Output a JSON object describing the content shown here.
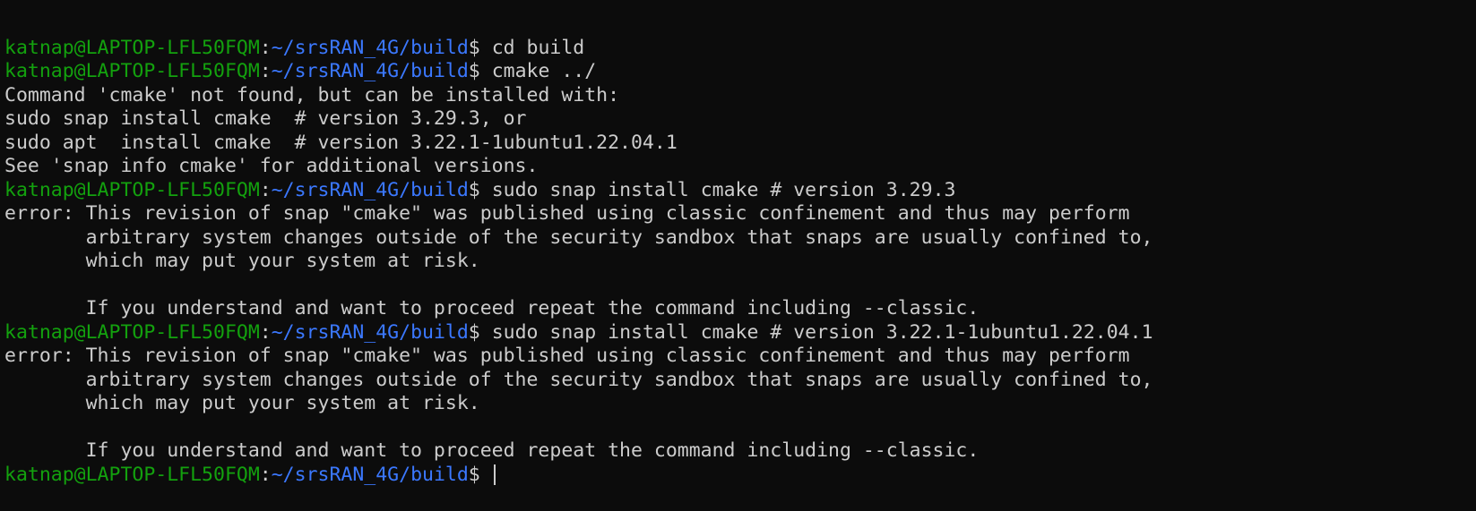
{
  "terminal": {
    "lines": [
      {
        "type": "prompt",
        "user": "katnap@LAPTOP-LFL50FQM",
        "colon": ":",
        "path": "~/srsRAN_4G/build",
        "dollar": "$",
        "command": " cd build"
      },
      {
        "type": "prompt",
        "user": "katnap@LAPTOP-LFL50FQM",
        "colon": ":",
        "path": "~/srsRAN_4G/build",
        "dollar": "$",
        "command": " cmake ../"
      },
      {
        "type": "output",
        "text": "Command 'cmake' not found, but can be installed with:"
      },
      {
        "type": "output",
        "text": "sudo snap install cmake  # version 3.29.3, or"
      },
      {
        "type": "output",
        "text": "sudo apt  install cmake  # version 3.22.1-1ubuntu1.22.04.1"
      },
      {
        "type": "output",
        "text": "See 'snap info cmake' for additional versions."
      },
      {
        "type": "prompt",
        "user": "katnap@LAPTOP-LFL50FQM",
        "colon": ":",
        "path": "~/srsRAN_4G/build",
        "dollar": "$",
        "command": " sudo snap install cmake # version 3.29.3"
      },
      {
        "type": "output",
        "text": "error: This revision of snap \"cmake\" was published using classic confinement and thus may perform"
      },
      {
        "type": "output",
        "text": "       arbitrary system changes outside of the security sandbox that snaps are usually confined to,"
      },
      {
        "type": "output",
        "text": "       which may put your system at risk."
      },
      {
        "type": "output",
        "text": ""
      },
      {
        "type": "output",
        "text": "       If you understand and want to proceed repeat the command including --classic."
      },
      {
        "type": "prompt",
        "user": "katnap@LAPTOP-LFL50FQM",
        "colon": ":",
        "path": "~/srsRAN_4G/build",
        "dollar": "$",
        "command": " sudo snap install cmake # version 3.22.1-1ubuntu1.22.04.1"
      },
      {
        "type": "output",
        "text": "error: This revision of snap \"cmake\" was published using classic confinement and thus may perform"
      },
      {
        "type": "output",
        "text": "       arbitrary system changes outside of the security sandbox that snaps are usually confined to,"
      },
      {
        "type": "output",
        "text": "       which may put your system at risk."
      },
      {
        "type": "output",
        "text": ""
      },
      {
        "type": "output",
        "text": "       If you understand and want to proceed repeat the command including --classic."
      },
      {
        "type": "prompt",
        "user": "katnap@LAPTOP-LFL50FQM",
        "colon": ":",
        "path": "~/srsRAN_4G/build",
        "dollar": "$",
        "command": " ",
        "cursor": true
      }
    ]
  },
  "colors": {
    "background": "#0c0c0c",
    "text": "#cccccc",
    "prompt_user": "#13a10e",
    "prompt_path": "#3b78ff"
  }
}
